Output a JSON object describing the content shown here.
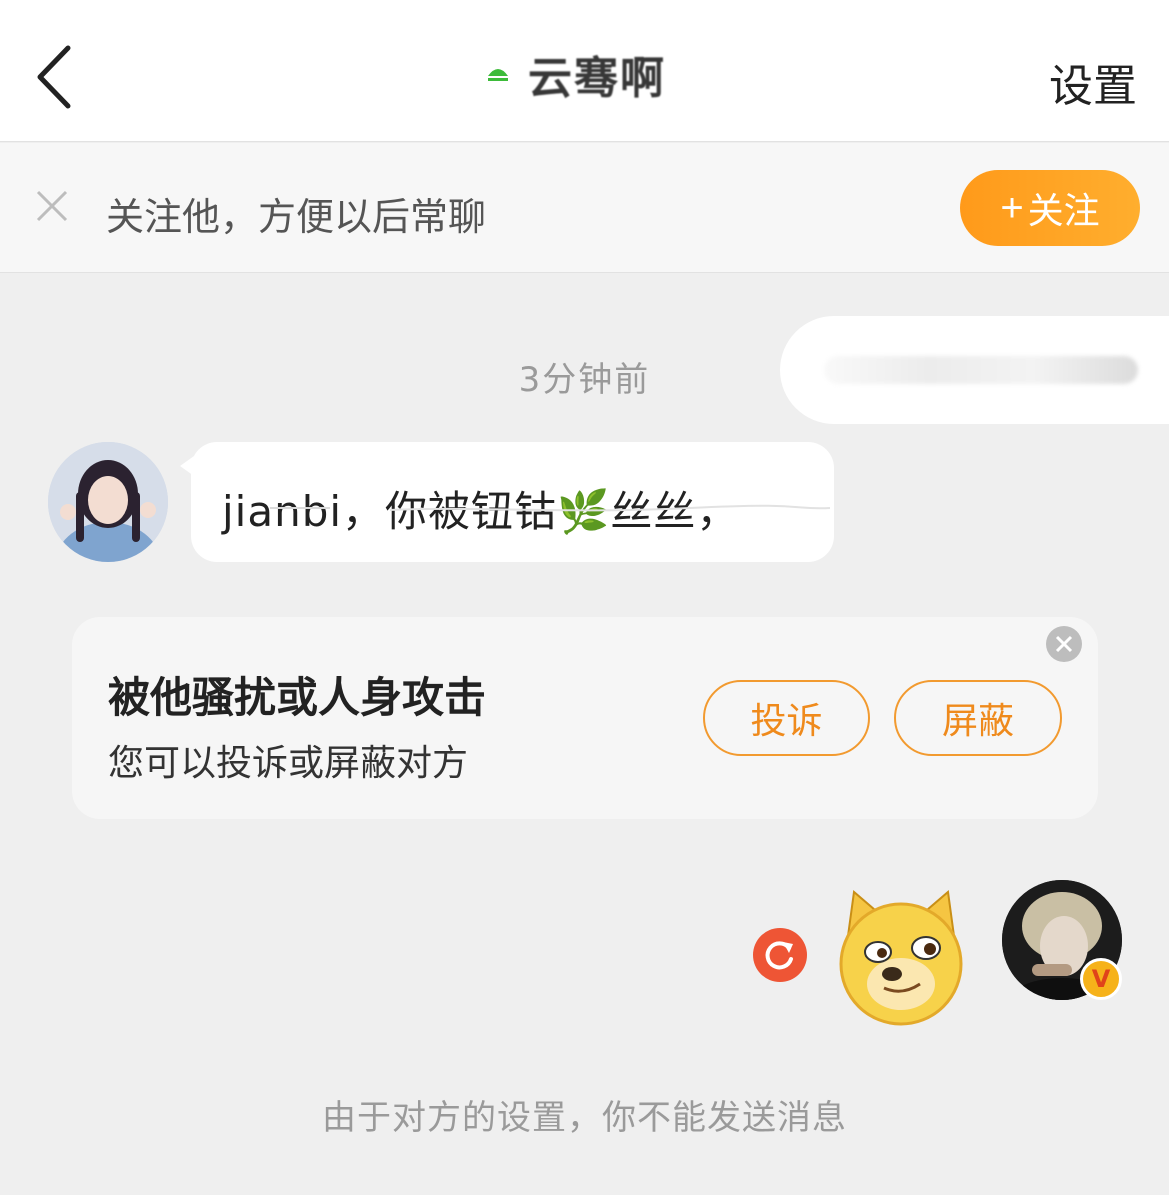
{
  "header": {
    "back_icon": "chevron-left-icon",
    "title": "云骞啊",
    "settings_label": "设置"
  },
  "follow_bar": {
    "close_icon": "close-icon",
    "prompt": "关注他，方便以后常聊",
    "follow_label": "关注",
    "follow_plus": "+",
    "accent": "#ff9a1a"
  },
  "chat": {
    "timestamp": "3分钟前",
    "incoming_message": "jianbi，你被钮钴🌿丝丝，",
    "retry_icon": "retry-icon"
  },
  "harassment_card": {
    "title": "被他骚扰或人身攻击",
    "subtitle": "您可以投诉或屏蔽对方",
    "report_label": "投诉",
    "block_label": "屏蔽",
    "accent": "#ef8a1c"
  },
  "footer": {
    "notice": "由于对方的设置，你不能发送消息"
  },
  "badge": {
    "label": "V"
  }
}
